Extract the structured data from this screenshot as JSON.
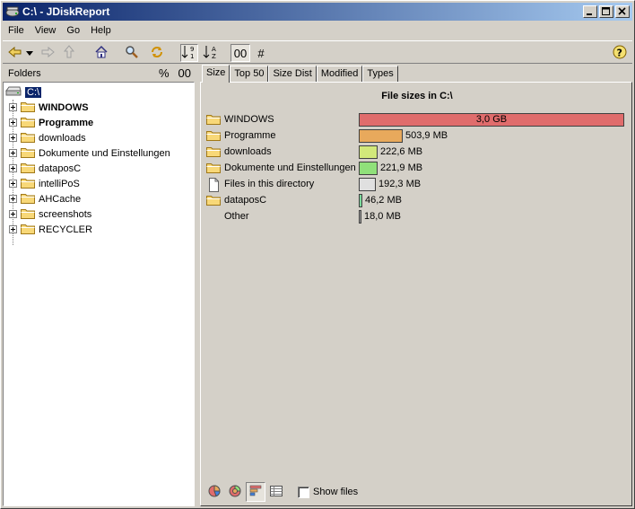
{
  "window": {
    "title": "C:\\ - JDiskReport"
  },
  "menu": {
    "file": "File",
    "view": "View",
    "go": "Go",
    "help": "Help"
  },
  "toolbar": {
    "sort_size_label": "00",
    "sort_count_label": "#"
  },
  "folders_panel": {
    "title": "Folders",
    "percent_label": "%",
    "size_label": "00",
    "root": "C:\\",
    "items": [
      {
        "label": "WINDOWS",
        "bold": true
      },
      {
        "label": "Programme",
        "bold": true
      },
      {
        "label": "downloads",
        "bold": false
      },
      {
        "label": "Dokumente und Einstellungen",
        "bold": false
      },
      {
        "label": "dataposC",
        "bold": false
      },
      {
        "label": "intelliPoS",
        "bold": false
      },
      {
        "label": "AHCache",
        "bold": false
      },
      {
        "label": "screenshots",
        "bold": false
      },
      {
        "label": "RECYCLER",
        "bold": false
      }
    ]
  },
  "tabs": [
    {
      "label": "Size",
      "active": true
    },
    {
      "label": "Top 50",
      "active": false
    },
    {
      "label": "Size Dist",
      "active": false
    },
    {
      "label": "Modified",
      "active": false
    },
    {
      "label": "Types",
      "active": false
    }
  ],
  "chart_data": {
    "type": "bar",
    "title": "File sizes in C:\\",
    "unit_note": "sizes in MB",
    "categories": [
      "WINDOWS",
      "Programme",
      "downloads",
      "Dokumente und Einstellungen",
      "Files in this directory",
      "dataposC",
      "Other"
    ],
    "values": [
      3072,
      503.9,
      222.6,
      221.9,
      192.3,
      46.2,
      18.0
    ],
    "labels": [
      "3,0 GB",
      "503,9 MB",
      "222,6 MB",
      "221,9 MB",
      "192,3 MB",
      "46,2 MB",
      "18,0 MB"
    ],
    "icons": [
      "folder",
      "folder",
      "folder",
      "folder",
      "file",
      "folder",
      "none"
    ],
    "colors": [
      "#e06c6c",
      "#e8a95c",
      "#d2e87a",
      "#90e07a",
      "#e0e0e0",
      "#7ad89a",
      "#a0a0a0"
    ]
  },
  "bottom": {
    "show_files_label": "Show files"
  },
  "colors": {
    "selection": "#0a246a",
    "title_start": "#0a246a",
    "title_end": "#a6caf0"
  }
}
